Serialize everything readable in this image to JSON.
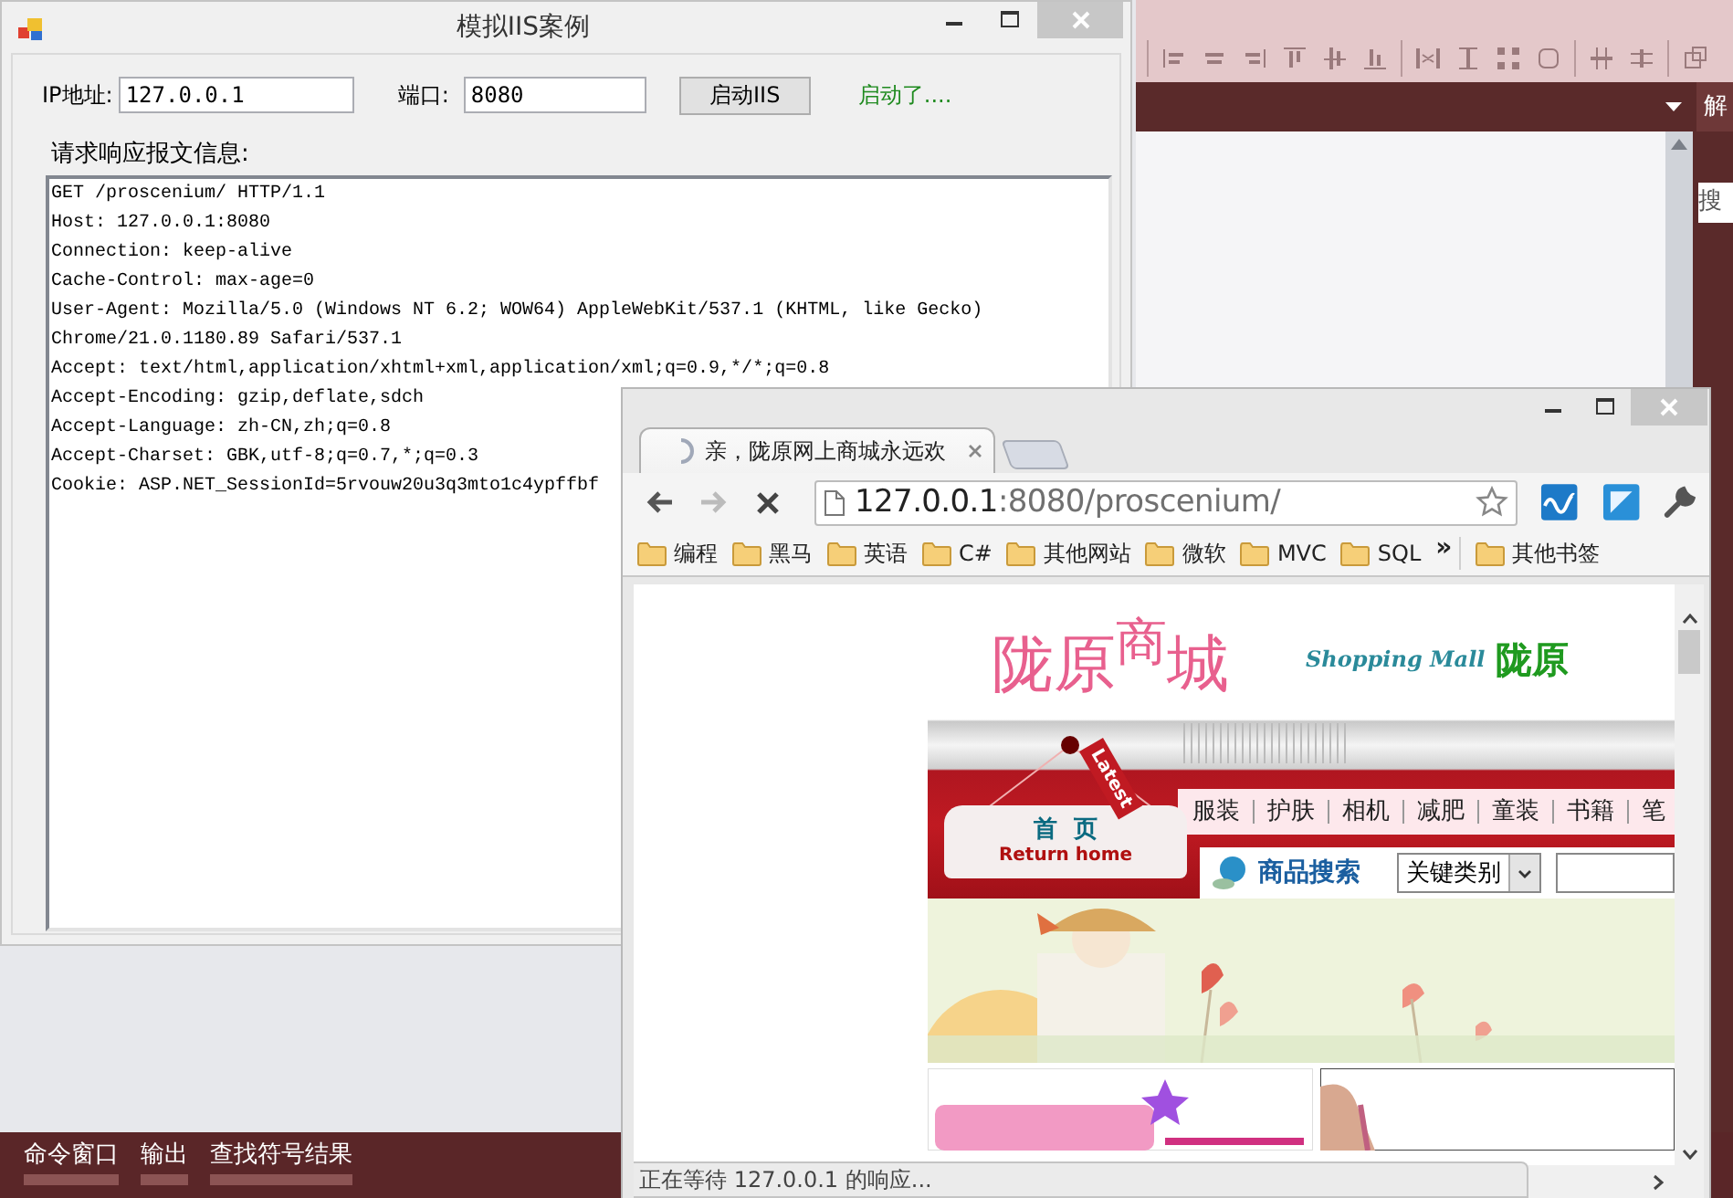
{
  "ide": {
    "panel_tab": "解",
    "panel_search_hint": "搜",
    "bottom_tabs": [
      {
        "label": "命令窗口"
      },
      {
        "label": "输出"
      },
      {
        "label": "查找符号结果"
      }
    ]
  },
  "form_window": {
    "title": "模拟IIS案例",
    "ip_label": "IP地址:",
    "ip_value": "127.0.0.1",
    "port_label": "端口:",
    "port_value": "8080",
    "start_button": "启动IIS",
    "status": "启动了....",
    "log_label": "请求响应报文信息:",
    "log_lines": [
      "GET /proscenium/ HTTP/1.1",
      "Host: 127.0.0.1:8080",
      "Connection: keep-alive",
      "Cache-Control: max-age=0",
      "User-Agent: Mozilla/5.0 (Windows NT 6.2; WOW64) AppleWebKit/537.1 (KHTML, like Gecko)",
      "Chrome/21.0.1180.89 Safari/537.1",
      "Accept: text/html,application/xhtml+xml,application/xml;q=0.9,*/*;q=0.8",
      "Accept-Encoding: gzip,deflate,sdch",
      "Accept-Language: zh-CN,zh;q=0.8",
      "Accept-Charset: GBK,utf-8;q=0.7,*;q=0.3",
      "Cookie: ASP.NET_SessionId=5rvouw20u3q3mto1c4ypffbf"
    ]
  },
  "browser": {
    "tab_title": "亲，陇原网上商城永远欢",
    "url_host": "127.0.0.1",
    "url_rest": ":8080/proscenium/",
    "bookmarks": [
      {
        "label": "编程"
      },
      {
        "label": "黑马"
      },
      {
        "label": "英语"
      },
      {
        "label": "C#"
      },
      {
        "label": "其他网站"
      },
      {
        "label": "微软"
      },
      {
        "label": "MVC"
      },
      {
        "label": "SQL"
      }
    ],
    "more_bookmarks": "»",
    "other_bookmarks": "其他书签",
    "status": "正在等待 127.0.0.1 的响应...",
    "page": {
      "logo": "陇原$^{商}$城",
      "logo_en": "Shopping Mall",
      "logo_cn": "陇原",
      "ribbon": "Latest",
      "home": "首  页",
      "home_en": "Return home",
      "nav": [
        {
          "label": "服装"
        },
        {
          "label": "护肤"
        },
        {
          "label": "相机"
        },
        {
          "label": "减肥"
        },
        {
          "label": "童装"
        },
        {
          "label": "书籍"
        },
        {
          "label": "笔"
        }
      ],
      "search_label": "商品搜索",
      "search_category": "关键类别"
    }
  }
}
